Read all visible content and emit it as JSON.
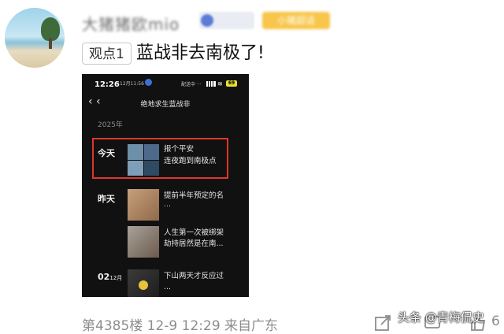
{
  "comment": {
    "username": "大猪猪欧mio",
    "badge_gold": "小猪超话",
    "tag": "观点1",
    "text": "蓝战非去南极了!",
    "floor_info": "第4385楼 12-9 12:29 来自广东",
    "like_count": "6"
  },
  "screenshot": {
    "status_time": "12:26",
    "status_sub": "12月11:56",
    "status_mid": "配送中 ···",
    "battery": "69",
    "back_icon": "chevron-left-icon",
    "title": "绝地求生蓝战非",
    "year": "2025年",
    "posts": [
      {
        "day": "今天",
        "day_suffix": "",
        "line1": "报个平安",
        "line2": "连夜跑到南极点"
      },
      {
        "day": "昨天",
        "day_suffix": "",
        "line1": "提前半年预定的名",
        "line2": ""
      },
      {
        "day": "",
        "day_suffix": "",
        "line1": "人生第一次被绑架",
        "line2": "劫持居然是在南..."
      },
      {
        "day": "02",
        "day_suffix": "12月",
        "line1": "下山两天才反应过",
        "line2": "..."
      }
    ],
    "highlight_color": "#e0352b"
  },
  "watermark": {
    "text": "头条 @青梅侃史"
  }
}
